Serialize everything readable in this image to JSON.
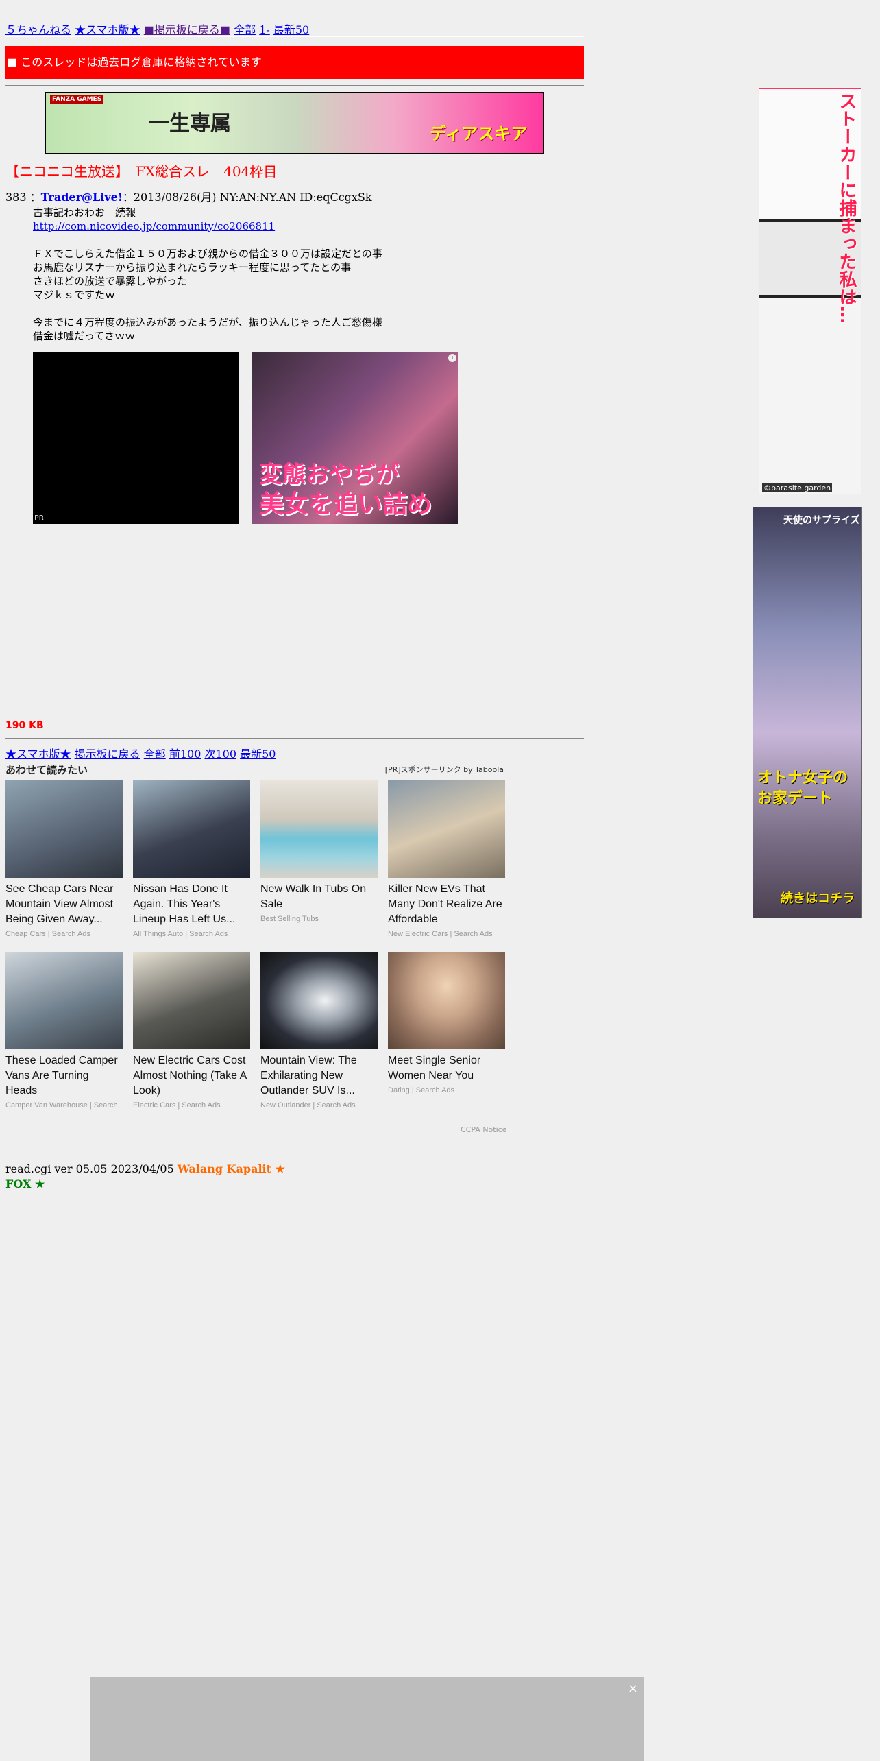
{
  "nav_top": {
    "site": "５ちゃんねる",
    "mobile": "★スマホ版★",
    "back_board": "■掲示板に戻る■",
    "all": "全部",
    "from1": "1-",
    "latest50": "最新50"
  },
  "archive_notice": "■ このスレッドは過去ログ倉庫に格納されています",
  "top_banner": {
    "badge": "FANZA GAMES",
    "text1": "一生専属",
    "text2": "ディアスキア"
  },
  "thread_title": "【ニコニコ生放送】　FX総合スレ　404枠目",
  "post": {
    "number": "383",
    "sep": "：",
    "name": "Trader@Live!",
    "sep2": "：",
    "date": "2013/08/26(月) NY:AN:NY.AN ID:eqCcgxSk",
    "lines": [
      "古事記わおわお　続報",
      "http://com.nicovideo.jp/community/co2066811",
      "",
      "ＦＸでこしらえた借金１５０万および親からの借金３００万は設定だとの事",
      "お馬鹿なリスナーから振り込まれたらラッキー程度に思ってたとの事",
      "さきほどの放送で暴露しやがった",
      "マジｋｓですたｗ",
      "",
      "今までに４万程度の振込みがあったようだが、振り込んじゃった人ご愁傷様",
      "借金は嘘だってさｗｗ"
    ]
  },
  "ads": {
    "black_label": "PR",
    "manga_info": "i",
    "manga_text1": "変態おやぢが",
    "manga_text2": "美女を追い詰める!!"
  },
  "size_label": "190 KB",
  "nav_bottom": {
    "mobile": "★スマホ版★",
    "back_board": "掲示板に戻る",
    "all": "全部",
    "prev100": "前100",
    "next100": "次100",
    "latest50": "最新50"
  },
  "taboola": {
    "heading": "あわせて読みたい",
    "sponsor": "[PR]スポンサーリンク by Taboola",
    "cards": [
      {
        "title": "See Cheap Cars Near Mountain View Almost Being Given Away...",
        "source": "Cheap Cars | Search Ads",
        "color": "#556070"
      },
      {
        "title": "Nissan Has Done It Again. This Year's Lineup Has Left Us...",
        "source": "All Things Auto | Search Ads",
        "color": "#3a4050"
      },
      {
        "title": "New Walk In Tubs On Sale",
        "source": "Best Selling Tubs",
        "color": "#9fd4e0"
      },
      {
        "title": "Killer New EVs That Many Don't Realize Are Affordable",
        "source": "New Electric Cars | Search Ads",
        "color": "#d8c9b0"
      },
      {
        "title": "These Loaded Camper Vans Are Turning Heads",
        "source": "Camper Van Warehouse | Search",
        "color": "#6f7f8c"
      },
      {
        "title": "New Electric Cars Cost Almost Nothing (Take A Look)",
        "source": "Electric Cars | Search Ads",
        "color": "#5a5a55"
      },
      {
        "title": "Mountain View: The Exhilarating New Outlander SUV Is...",
        "source": "New Outlander | Search Ads",
        "color": "#2a2e38"
      },
      {
        "title": "Meet Single Senior Women Near You",
        "source": "Dating | Search Ads",
        "color": "#c9a58a"
      }
    ],
    "ccpa": "CCPA Notice"
  },
  "footer": {
    "version": "read.cgi ver 05.05 2023/04/05",
    "walang": "Walang Kapalit ★",
    "fox": "FOX ★"
  },
  "side_ads": {
    "ad1_text": "ストーカーに捕まった私は…",
    "ad1_credit": "©parasite garden",
    "ad2_top": "天使のサプライズ",
    "ad2_mid": "オトナ女子の\nお家デート",
    "ad2_bot": "続きはコチラ"
  },
  "bottom_ad": {
    "close": "×"
  }
}
